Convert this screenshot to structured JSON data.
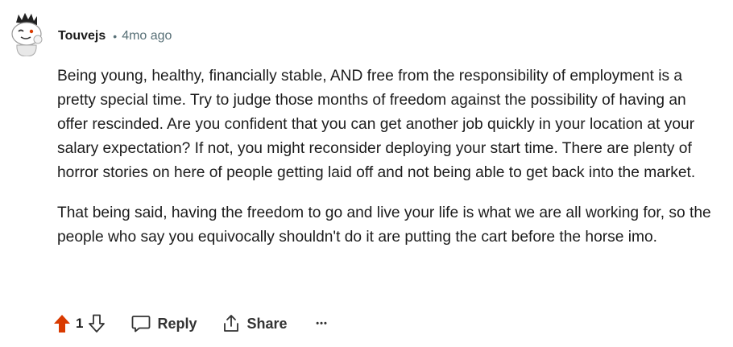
{
  "comment": {
    "author": "Touvejs",
    "separator": "•",
    "time": "4mo ago",
    "paragraphs": [
      "Being young, healthy, financially stable, AND free from the responsibility of employment is a pretty special time. Try to judge those months of freedom against the possibility of having an offer rescinded. Are you confident that you can get another job quickly in your location at your salary expectation? If not, you might reconsider deploying your start time. There are plenty of horror stories on here of people getting laid off and not being able to get back into the market.",
      "That being said, having the freedom to go and live your life is what we are all working for, so the people who say you equivocally shouldn't do it are putting the cart before the horse imo."
    ]
  },
  "actions": {
    "score": "1",
    "reply_label": "Reply",
    "share_label": "Share",
    "more_label": "•••",
    "upvote_icon": "upvote-icon",
    "downvote_icon": "downvote-icon",
    "reply_icon": "comment-bubble-icon",
    "share_icon": "share-icon"
  },
  "colors": {
    "upvote_active": "#d93a00",
    "text": "#1c1c1c",
    "muted": "#576f76"
  }
}
